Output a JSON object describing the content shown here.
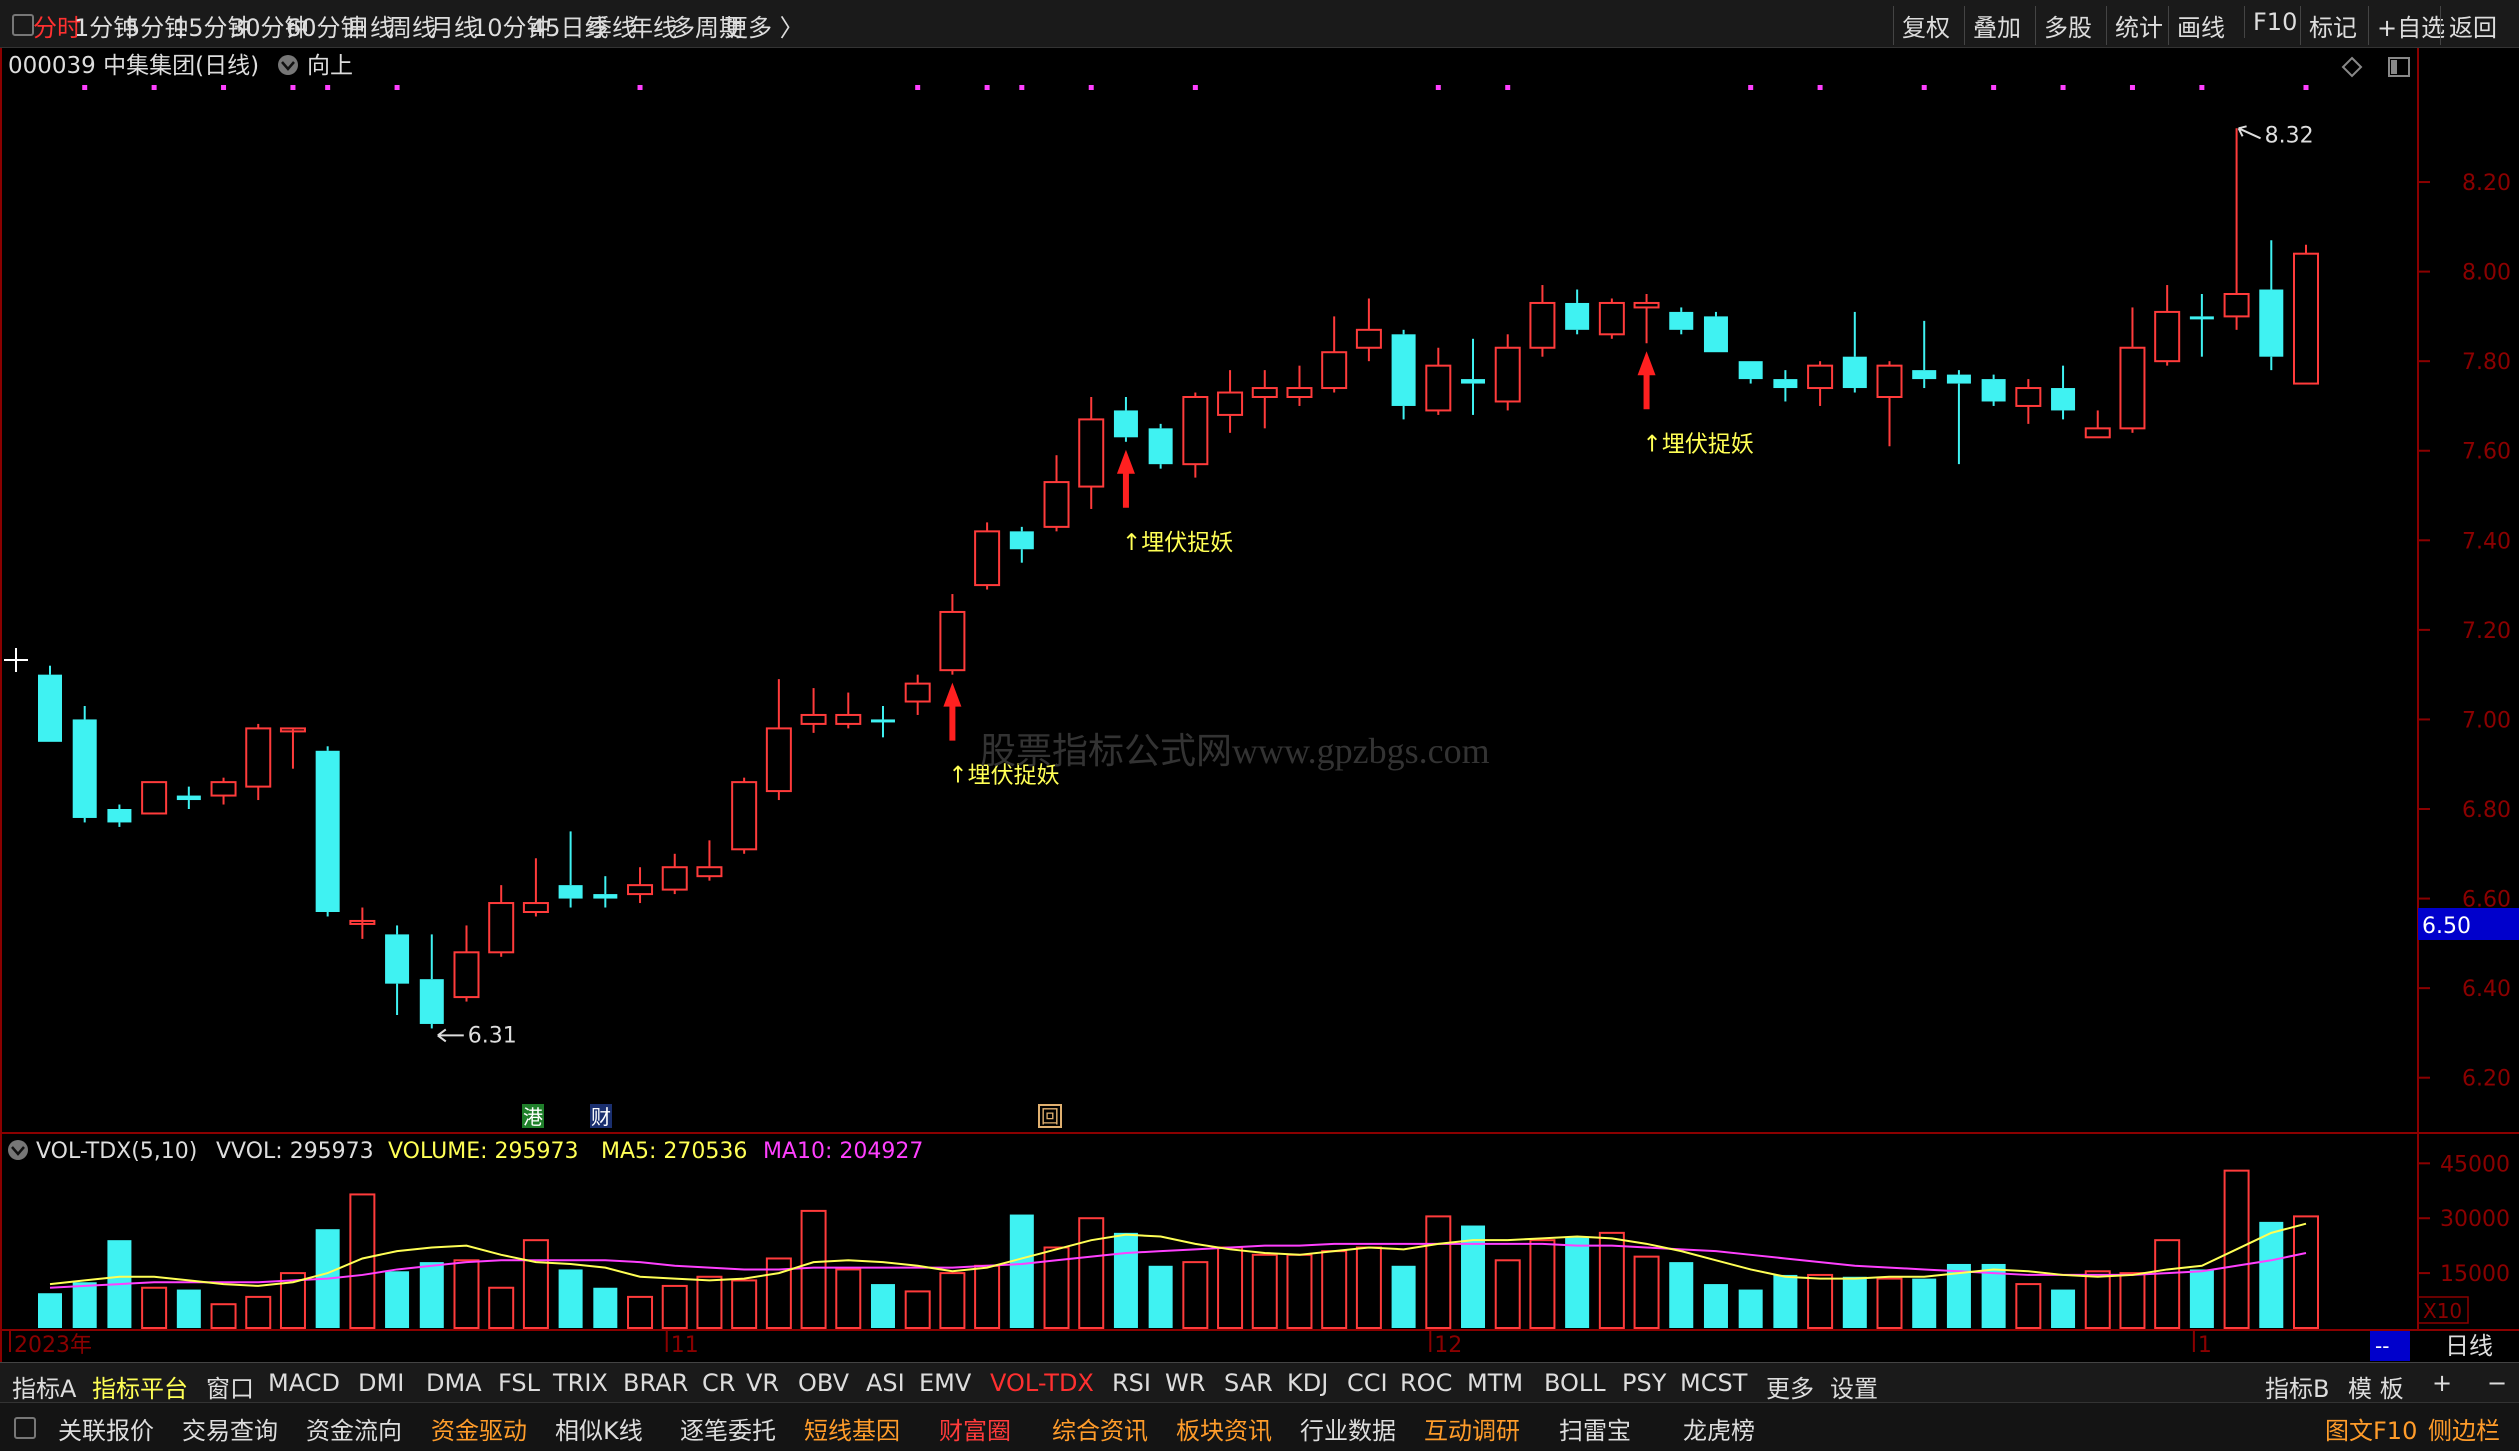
{
  "colors": {
    "up": "#ff3b3b",
    "down": "#3ff2f2",
    "bg": "#000000",
    "grid_red": "#8b0000",
    "text_yellow": "#ffff55",
    "magenta": "#ff40ff",
    "accent": "#ff3030"
  },
  "top_toolbar": {
    "left_items": [
      {
        "label": "分时",
        "active": true
      },
      {
        "label": "1分钟"
      },
      {
        "label": "5分钟"
      },
      {
        "label": "15分钟"
      },
      {
        "label": "30分钟"
      },
      {
        "label": "60分钟"
      },
      {
        "label": "日线"
      },
      {
        "label": "周线"
      },
      {
        "label": "月线"
      },
      {
        "label": "10分钟"
      },
      {
        "label": "45日线"
      },
      {
        "label": "季线"
      },
      {
        "label": "年线"
      },
      {
        "label": "多周期"
      },
      {
        "label": "更多 〉"
      }
    ],
    "right_items": [
      "复权",
      "叠加",
      "多股",
      "统计",
      "画线",
      "F10",
      "标记",
      "+自选",
      "返回"
    ]
  },
  "chart_header": {
    "code_name": "000039 中集集团(日线)",
    "indicator": "向上"
  },
  "watermark": "股票指标公式网www.gpzbgs.com",
  "current_price_label": "6.50",
  "high_label": "8.32",
  "low_label": "6.31",
  "signal_label": "↑埋伏捉妖",
  "markers": {
    "gang": "港",
    "cai": "财",
    "hui": "回"
  },
  "volume_header": {
    "name": "VOL-TDX(5,10)",
    "vvol": "VVOL: 295973",
    "volume": "VOLUME: 295973",
    "ma5": "MA5: 270536",
    "ma10": "MA10: 204927"
  },
  "vol_axis": {
    "ticks": [
      "45000",
      "30000",
      "15000"
    ],
    "unit": "X10"
  },
  "period_label": "日线",
  "period_dash": "--",
  "chart_data": {
    "type": "candlestick",
    "price_axis": {
      "ticks": [
        "8.20",
        "8.00",
        "7.80",
        "7.60",
        "7.40",
        "7.20",
        "7.00",
        "6.80",
        "6.60",
        "6.40",
        "6.20"
      ],
      "range": [
        6.11,
        8.41
      ]
    },
    "x_labels": [
      {
        "label": "2023年",
        "index": 0
      },
      {
        "label": "11",
        "index": 18
      },
      {
        "label": "12",
        "index": 40
      },
      {
        "label": "1",
        "index": 62
      }
    ],
    "candles": [
      {
        "o": 6.95,
        "c": 7.1,
        "h": 7.12,
        "l": 6.95,
        "up": false
      },
      {
        "o": 7.0,
        "c": 6.78,
        "h": 7.03,
        "l": 6.77,
        "up": false
      },
      {
        "o": 6.8,
        "c": 6.77,
        "h": 6.81,
        "l": 6.76,
        "up": false
      },
      {
        "o": 6.79,
        "c": 6.86,
        "h": 6.86,
        "l": 6.79,
        "up": true
      },
      {
        "o": 6.83,
        "c": 6.82,
        "h": 6.85,
        "l": 6.8,
        "up": false
      },
      {
        "o": 6.83,
        "c": 6.86,
        "h": 6.87,
        "l": 6.81,
        "up": true
      },
      {
        "o": 6.85,
        "c": 6.98,
        "h": 6.99,
        "l": 6.82,
        "up": true
      },
      {
        "o": 6.98,
        "c": 6.98,
        "h": 6.98,
        "l": 6.89,
        "up": true
      },
      {
        "o": 6.93,
        "c": 6.57,
        "h": 6.94,
        "l": 6.56,
        "up": false
      },
      {
        "o": 6.55,
        "c": 6.55,
        "h": 6.58,
        "l": 6.51,
        "up": true
      },
      {
        "o": 6.52,
        "c": 6.41,
        "h": 6.54,
        "l": 6.34,
        "up": false
      },
      {
        "o": 6.42,
        "c": 6.32,
        "h": 6.52,
        "l": 6.31,
        "up": false
      },
      {
        "o": 6.38,
        "c": 6.48,
        "h": 6.54,
        "l": 6.37,
        "up": true
      },
      {
        "o": 6.48,
        "c": 6.59,
        "h": 6.63,
        "l": 6.47,
        "up": true
      },
      {
        "o": 6.57,
        "c": 6.59,
        "h": 6.69,
        "l": 6.56,
        "up": true
      },
      {
        "o": 6.63,
        "c": 6.6,
        "h": 6.75,
        "l": 6.58,
        "up": false
      },
      {
        "o": 6.6,
        "c": 6.61,
        "h": 6.65,
        "l": 6.58,
        "up": false
      },
      {
        "o": 6.61,
        "c": 6.63,
        "h": 6.67,
        "l": 6.59,
        "up": true
      },
      {
        "o": 6.62,
        "c": 6.67,
        "h": 6.7,
        "l": 6.61,
        "up": true
      },
      {
        "o": 6.65,
        "c": 6.67,
        "h": 6.73,
        "l": 6.64,
        "up": true
      },
      {
        "o": 6.71,
        "c": 6.86,
        "h": 6.87,
        "l": 6.7,
        "up": true
      },
      {
        "o": 6.84,
        "c": 6.98,
        "h": 7.09,
        "l": 6.82,
        "up": true
      },
      {
        "o": 6.99,
        "c": 7.01,
        "h": 7.07,
        "l": 6.97,
        "up": true
      },
      {
        "o": 6.99,
        "c": 7.01,
        "h": 7.06,
        "l": 6.98,
        "up": true
      },
      {
        "o": 7.0,
        "c": 7.0,
        "h": 7.03,
        "l": 6.96,
        "up": false
      },
      {
        "o": 7.04,
        "c": 7.08,
        "h": 7.1,
        "l": 7.01,
        "up": true
      },
      {
        "o": 7.11,
        "c": 7.24,
        "h": 7.28,
        "l": 7.1,
        "up": true
      },
      {
        "o": 7.3,
        "c": 7.42,
        "h": 7.44,
        "l": 7.29,
        "up": true
      },
      {
        "o": 7.42,
        "c": 7.38,
        "h": 7.43,
        "l": 7.35,
        "up": false
      },
      {
        "o": 7.43,
        "c": 7.53,
        "h": 7.59,
        "l": 7.42,
        "up": true
      },
      {
        "o": 7.52,
        "c": 7.67,
        "h": 7.72,
        "l": 7.47,
        "up": true
      },
      {
        "o": 7.69,
        "c": 7.63,
        "h": 7.72,
        "l": 7.62,
        "up": false
      },
      {
        "o": 7.65,
        "c": 7.57,
        "h": 7.66,
        "l": 7.56,
        "up": false
      },
      {
        "o": 7.57,
        "c": 7.72,
        "h": 7.73,
        "l": 7.54,
        "up": true
      },
      {
        "o": 7.68,
        "c": 7.73,
        "h": 7.78,
        "l": 7.64,
        "up": true
      },
      {
        "o": 7.72,
        "c": 7.74,
        "h": 7.78,
        "l": 7.65,
        "up": true
      },
      {
        "o": 7.72,
        "c": 7.74,
        "h": 7.79,
        "l": 7.7,
        "up": true
      },
      {
        "o": 7.74,
        "c": 7.82,
        "h": 7.9,
        "l": 7.73,
        "up": true
      },
      {
        "o": 7.83,
        "c": 7.87,
        "h": 7.94,
        "l": 7.8,
        "up": true
      },
      {
        "o": 7.86,
        "c": 7.7,
        "h": 7.87,
        "l": 7.67,
        "up": false
      },
      {
        "o": 7.69,
        "c": 7.79,
        "h": 7.83,
        "l": 7.68,
        "up": true
      },
      {
        "o": 7.75,
        "c": 7.76,
        "h": 7.85,
        "l": 7.68,
        "up": false
      },
      {
        "o": 7.71,
        "c": 7.83,
        "h": 7.86,
        "l": 7.69,
        "up": true
      },
      {
        "o": 7.83,
        "c": 7.93,
        "h": 7.97,
        "l": 7.81,
        "up": true
      },
      {
        "o": 7.93,
        "c": 7.87,
        "h": 7.96,
        "l": 7.86,
        "up": false
      },
      {
        "o": 7.86,
        "c": 7.93,
        "h": 7.94,
        "l": 7.85,
        "up": true
      },
      {
        "o": 7.93,
        "c": 7.92,
        "h": 7.95,
        "l": 7.84,
        "up": true
      },
      {
        "o": 7.91,
        "c": 7.87,
        "h": 7.92,
        "l": 7.86,
        "up": false
      },
      {
        "o": 7.9,
        "c": 7.82,
        "h": 7.91,
        "l": 7.82,
        "up": false
      },
      {
        "o": 7.8,
        "c": 7.76,
        "h": 7.8,
        "l": 7.75,
        "up": false
      },
      {
        "o": 7.76,
        "c": 7.74,
        "h": 7.78,
        "l": 7.71,
        "up": false
      },
      {
        "o": 7.74,
        "c": 7.79,
        "h": 7.8,
        "l": 7.7,
        "up": true
      },
      {
        "o": 7.81,
        "c": 7.74,
        "h": 7.91,
        "l": 7.73,
        "up": false
      },
      {
        "o": 7.72,
        "c": 7.79,
        "h": 7.8,
        "l": 7.61,
        "up": true
      },
      {
        "o": 7.78,
        "c": 7.76,
        "h": 7.89,
        "l": 7.74,
        "up": false
      },
      {
        "o": 7.77,
        "c": 7.75,
        "h": 7.78,
        "l": 7.57,
        "up": false
      },
      {
        "o": 7.76,
        "c": 7.71,
        "h": 7.77,
        "l": 7.7,
        "up": false
      },
      {
        "o": 7.7,
        "c": 7.74,
        "h": 7.76,
        "l": 7.66,
        "up": true
      },
      {
        "o": 7.74,
        "c": 7.69,
        "h": 7.79,
        "l": 7.67,
        "up": false
      },
      {
        "o": 7.63,
        "c": 7.65,
        "h": 7.69,
        "l": 7.63,
        "up": true
      },
      {
        "o": 7.65,
        "c": 7.83,
        "h": 7.92,
        "l": 7.64,
        "up": true
      },
      {
        "o": 7.8,
        "c": 7.91,
        "h": 7.97,
        "l": 7.79,
        "up": true
      },
      {
        "o": 7.9,
        "c": 7.9,
        "h": 7.95,
        "l": 7.81,
        "up": false
      },
      {
        "o": 7.9,
        "c": 7.95,
        "h": 8.32,
        "l": 7.87,
        "up": true
      },
      {
        "o": 7.96,
        "c": 7.81,
        "h": 8.07,
        "l": 7.78,
        "up": false
      },
      {
        "o": 7.75,
        "c": 8.04,
        "h": 8.06,
        "l": 7.75,
        "up": true
      }
    ],
    "signals": [
      26,
      31,
      46
    ],
    "magenta_dots": [
      1,
      3,
      5,
      7,
      8,
      10,
      17,
      25,
      27,
      28,
      30,
      33,
      40,
      42,
      49,
      51,
      54,
      56,
      58,
      60,
      62,
      65
    ],
    "volume": {
      "axis": {
        "ticks": [
          45000,
          30000,
          15000
        ],
        "range": [
          0,
          47000
        ]
      },
      "values": [
        9500,
        12500,
        24000,
        11000,
        10500,
        6500,
        8500,
        15000,
        27000,
        36500,
        15500,
        18000,
        18500,
        11000,
        24000,
        16000,
        11000,
        8500,
        11500,
        14000,
        13000,
        19000,
        32000,
        16000,
        12000,
        10000,
        15000,
        17000,
        31000,
        22000,
        30000,
        26000,
        17000,
        18000,
        22000,
        20000,
        20000,
        21000,
        22000,
        17000,
        30500,
        28000,
        18500,
        24000,
        25000,
        26000,
        19500,
        18000,
        12000,
        10500,
        14500,
        14500,
        14000,
        13500,
        13500,
        17500,
        17500,
        12000,
        10500,
        15500,
        15000,
        24000,
        16000,
        43000,
        29000,
        30500
      ],
      "ma5": [
        12000,
        13000,
        14000,
        14000,
        13000,
        12000,
        11500,
        12500,
        15000,
        19000,
        21000,
        22000,
        22500,
        20000,
        18000,
        17500,
        16500,
        14000,
        13500,
        13000,
        13500,
        15000,
        18000,
        18500,
        18000,
        17000,
        15500,
        16500,
        19000,
        21500,
        24000,
        25500,
        25000,
        23000,
        21500,
        20500,
        20000,
        21000,
        22000,
        21500,
        23000,
        24000,
        24000,
        24500,
        25000,
        24500,
        23000,
        21000,
        18500,
        16000,
        14000,
        13500,
        13500,
        14000,
        14000,
        15000,
        16000,
        15500,
        14500,
        14000,
        14500,
        16000,
        17000,
        21500,
        26000,
        28500
      ],
      "ma10": [
        11000,
        11500,
        12000,
        12500,
        12500,
        12500,
        12500,
        13000,
        13500,
        14500,
        16000,
        17000,
        18000,
        18500,
        18500,
        18500,
        18500,
        18000,
        17000,
        16500,
        16000,
        16000,
        16500,
        16500,
        16500,
        16500,
        16500,
        17000,
        17500,
        18500,
        19500,
        20500,
        21000,
        21500,
        22000,
        22500,
        22500,
        23000,
        23000,
        23000,
        23000,
        23000,
        23000,
        23000,
        22500,
        22500,
        22000,
        21500,
        21000,
        20000,
        19000,
        18000,
        17000,
        16500,
        16000,
        15500,
        15000,
        14500,
        14500,
        14500,
        14500,
        15000,
        15500,
        17000,
        18500,
        20500
      ]
    }
  },
  "indicator_toolbar": {
    "items": [
      {
        "label": "指标A"
      },
      {
        "label": "指标平台",
        "highlight": "yellow"
      },
      {
        "label": "窗口"
      },
      {
        "label": "MACD"
      },
      {
        "label": "DMI"
      },
      {
        "label": "DMA"
      },
      {
        "label": "FSL"
      },
      {
        "label": "TRIX"
      },
      {
        "label": "BRAR"
      },
      {
        "label": "CR"
      },
      {
        "label": "VR"
      },
      {
        "label": "OBV"
      },
      {
        "label": "ASI"
      },
      {
        "label": "EMV"
      },
      {
        "label": "VOL-TDX",
        "highlight": "red"
      },
      {
        "label": "RSI"
      },
      {
        "label": "WR"
      },
      {
        "label": "SAR"
      },
      {
        "label": "KDJ"
      },
      {
        "label": "CCI"
      },
      {
        "label": "ROC"
      },
      {
        "label": "MTM"
      },
      {
        "label": "BOLL"
      },
      {
        "label": "PSY"
      },
      {
        "label": "MCST"
      },
      {
        "label": "更多"
      },
      {
        "label": "设置"
      }
    ],
    "right_items": [
      "指标B",
      "模 板",
      "+",
      "−"
    ]
  },
  "bottom_toolbar": {
    "items": [
      {
        "label": "关联报价",
        "color": "#dddddd"
      },
      {
        "label": "交易查询",
        "color": "#dddddd"
      },
      {
        "label": "资金流向",
        "color": "#dddddd"
      },
      {
        "label": "资金驱动",
        "color": "#ff9c2a"
      },
      {
        "label": "相似K线",
        "color": "#dddddd"
      },
      {
        "label": "逐笔委托",
        "color": "#dddddd"
      },
      {
        "label": "短线基因",
        "color": "#ff9c2a"
      },
      {
        "label": "财富圈",
        "color": "#ff3b3b"
      },
      {
        "label": "综合资讯",
        "color": "#ff9c2a"
      },
      {
        "label": "板块资讯",
        "color": "#ff9c2a"
      },
      {
        "label": "行业数据",
        "color": "#dddddd"
      },
      {
        "label": "互动调研",
        "color": "#ff9c2a"
      },
      {
        "label": "扫雷宝",
        "color": "#dddddd"
      },
      {
        "label": "龙虎榜",
        "color": "#dddddd"
      }
    ],
    "right_items": [
      {
        "label": "图文F10",
        "color": "#ff9c2a"
      },
      {
        "label": "侧边栏",
        "color": "#ff9c2a"
      }
    ]
  }
}
